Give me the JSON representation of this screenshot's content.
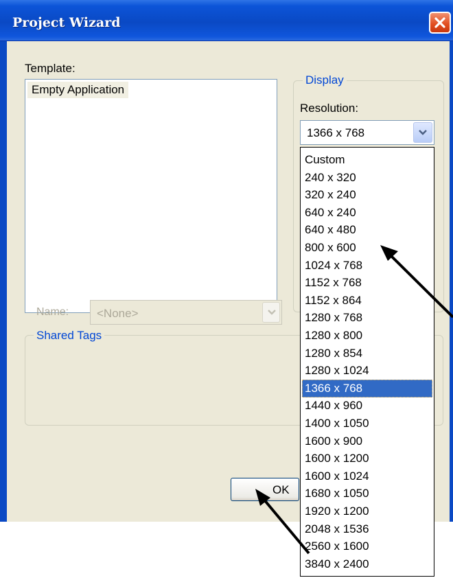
{
  "window": {
    "title": "Project Wizard"
  },
  "template": {
    "label": "Template:",
    "items": [
      "Empty Application"
    ]
  },
  "display": {
    "legend": "Display",
    "resolution_label": "Resolution:",
    "resolution_value": "1366 x 768",
    "options": [
      "Custom",
      "240 x 320",
      "320 x 240",
      "640 x 240",
      "640 x 480",
      "800 x 600",
      "1024 x 768",
      "1152 x 768",
      "1152 x 864",
      "1280 x 768",
      "1280 x 800",
      "1280 x 854",
      "1280 x 1024",
      "1366 x 768",
      "1440 x 960",
      "1400 x 1050",
      "1600 x 900",
      "1600 x 1200",
      "1600 x 1024",
      "1680 x 1050",
      "1920 x 1200",
      "2048 x 1536",
      "2560 x 1600",
      "3840 x 2400"
    ],
    "selected_index": 13
  },
  "shared_tags": {
    "legend": "Shared Tags",
    "name_label": "Name:",
    "name_value": "<None>"
  },
  "buttons": {
    "ok": "OK"
  },
  "colors": {
    "titlebar": "#0a49c4",
    "window_bg": "#ece9d8",
    "selection": "#316ac5",
    "group_legend": "#0046d5",
    "disabled_text": "#aca899",
    "annotation_arrow": "#000000"
  },
  "icons": {
    "close": "close-icon",
    "combo_arrow": "chevron-down-icon",
    "annotation": "arrow-pointer-icon"
  }
}
